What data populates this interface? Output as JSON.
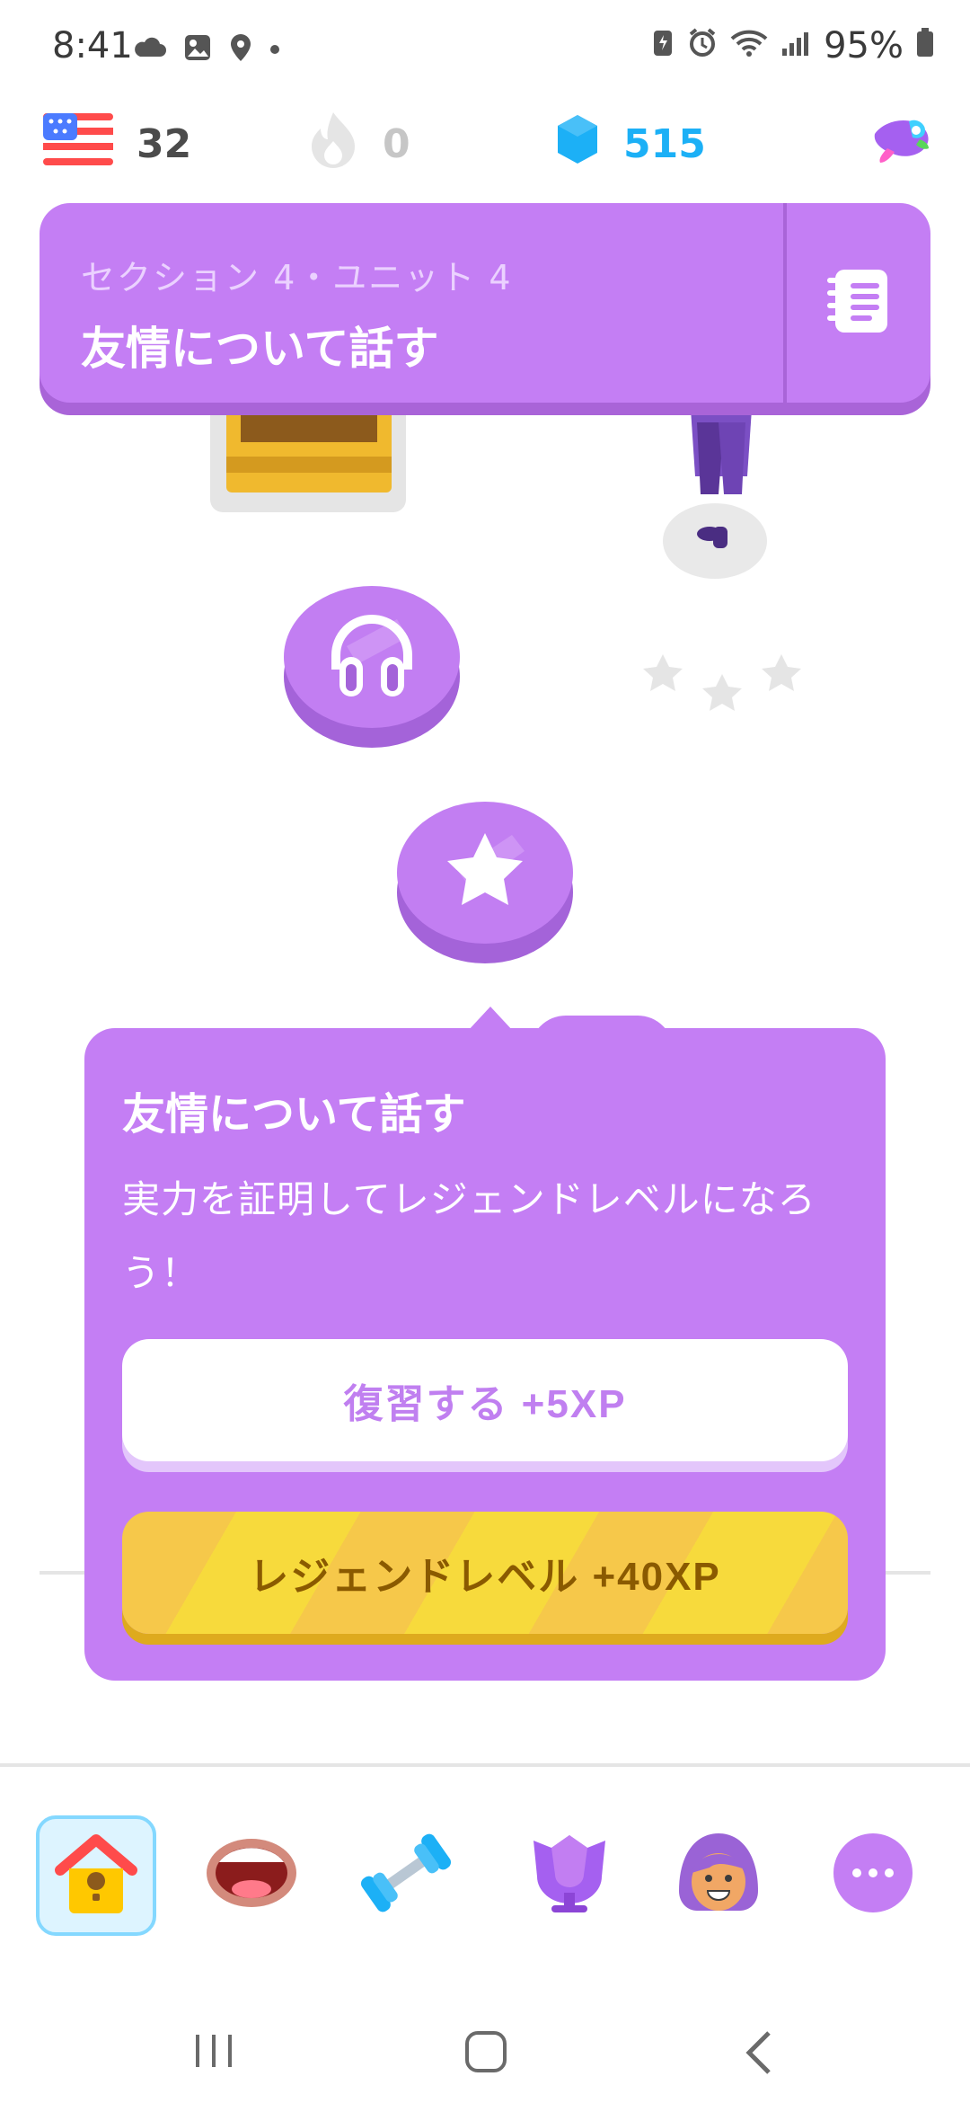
{
  "status_bar": {
    "time": "8:41",
    "battery": "95%"
  },
  "stats": {
    "language_count": "32",
    "streak": "0",
    "gems": "515"
  },
  "unit_banner": {
    "section_label": "セクション 4・ユニット 4",
    "title": "友情について話す"
  },
  "popup": {
    "title": "友情について話す",
    "description": "実力を証明してレジェンドレベルになろう！",
    "review_button": "復習する +5XP",
    "legend_button": "レジェンドレベル +40XP"
  },
  "tabs": [
    "home",
    "speaking",
    "practice",
    "leaderboard",
    "profile",
    "more"
  ],
  "colors": {
    "accent_purple": "#c47ef4",
    "gems_blue": "#1cb0f6",
    "legend_gold": "#f6c84a"
  }
}
